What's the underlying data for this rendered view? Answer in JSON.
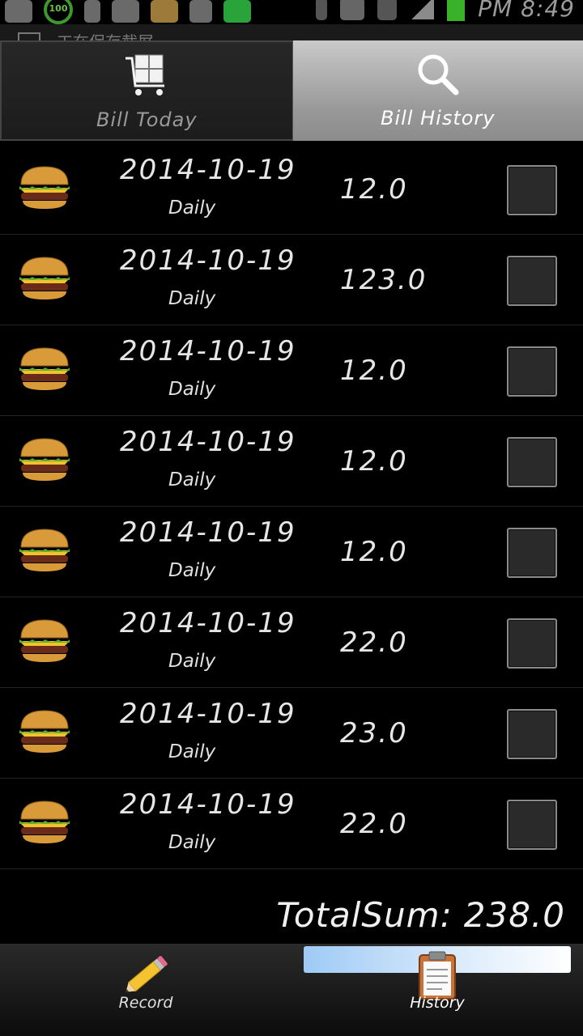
{
  "status_bar": {
    "time": "PM 8:49",
    "icons": [
      "add-icon",
      "battery-100-icon",
      "usb-icon",
      "image-icon",
      "broom-icon",
      "facebook-icon",
      "wechat-icon",
      "bluetooth-icon",
      "data-icon",
      "wifi-icon",
      "signal-icon",
      "battery-charging-icon"
    ]
  },
  "notification": {
    "text": "工在保存截屏"
  },
  "tabs": [
    {
      "label": "Bill Today",
      "icon": "cart-icon",
      "active": false
    },
    {
      "label": "Bill History",
      "icon": "search-icon",
      "active": true
    }
  ],
  "bills": [
    {
      "date": "2014-10-19",
      "category": "Daily",
      "amount": "12.0",
      "icon": "burger-icon",
      "checked": false
    },
    {
      "date": "2014-10-19",
      "category": "Daily",
      "amount": "123.0",
      "icon": "burger-icon",
      "checked": false
    },
    {
      "date": "2014-10-19",
      "category": "Daily",
      "amount": "12.0",
      "icon": "burger-icon",
      "checked": false
    },
    {
      "date": "2014-10-19",
      "category": "Daily",
      "amount": "12.0",
      "icon": "burger-icon",
      "checked": false
    },
    {
      "date": "2014-10-19",
      "category": "Daily",
      "amount": "12.0",
      "icon": "burger-icon",
      "checked": false
    },
    {
      "date": "2014-10-19",
      "category": "Daily",
      "amount": "22.0",
      "icon": "burger-icon",
      "checked": false
    },
    {
      "date": "2014-10-19",
      "category": "Daily",
      "amount": "23.0",
      "icon": "burger-icon",
      "checked": false
    },
    {
      "date": "2014-10-19",
      "category": "Daily",
      "amount": "22.0",
      "icon": "burger-icon",
      "checked": false
    }
  ],
  "total": {
    "label": "TotalSum:",
    "value": "238.0"
  },
  "bottom_nav": [
    {
      "label": "Record",
      "icon": "pencil-icon",
      "active": false
    },
    {
      "label": "History",
      "icon": "clipboard-icon",
      "active": true
    }
  ]
}
